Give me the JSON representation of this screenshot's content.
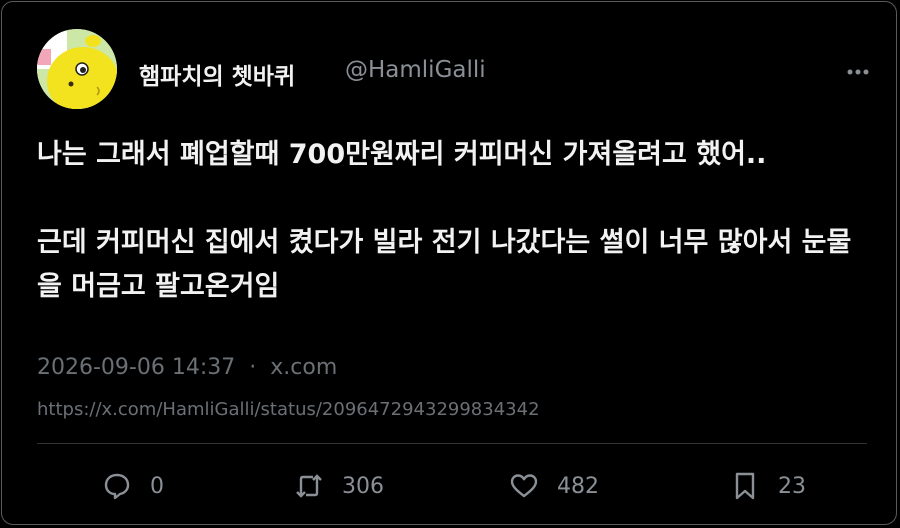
{
  "tweet": {
    "display_name": "햄파치의 쳇바퀴",
    "handle": "@HamliGalli",
    "body_line1": "나는 그래서 폐업할때 700만원짜리 커피머신 가져올려고 했어..",
    "body_line2": "근데 커피머신 집에서 켰다가 빌라 전기 나갔다는 썰이 너무 많아서 눈물을 머금고 팔고온거임",
    "timestamp": "2026-09-06 14:37",
    "source": "x.com",
    "separator": "·",
    "status_url": "https://x.com/HamliGalli/status/2096472943299834342"
  },
  "actions": {
    "replies": "0",
    "reposts": "306",
    "likes": "482",
    "bookmarks": "23"
  },
  "icons": {
    "more": "more-horizontal-icon",
    "reply": "reply-bubble-icon",
    "repost": "repost-icon",
    "like": "heart-icon",
    "bookmark": "bookmark-icon"
  },
  "colors": {
    "background": "#000000",
    "text_primary": "#f2f2f2",
    "text_secondary": "#8b9096",
    "meta": "#6b7075",
    "divider": "#2f3336"
  }
}
